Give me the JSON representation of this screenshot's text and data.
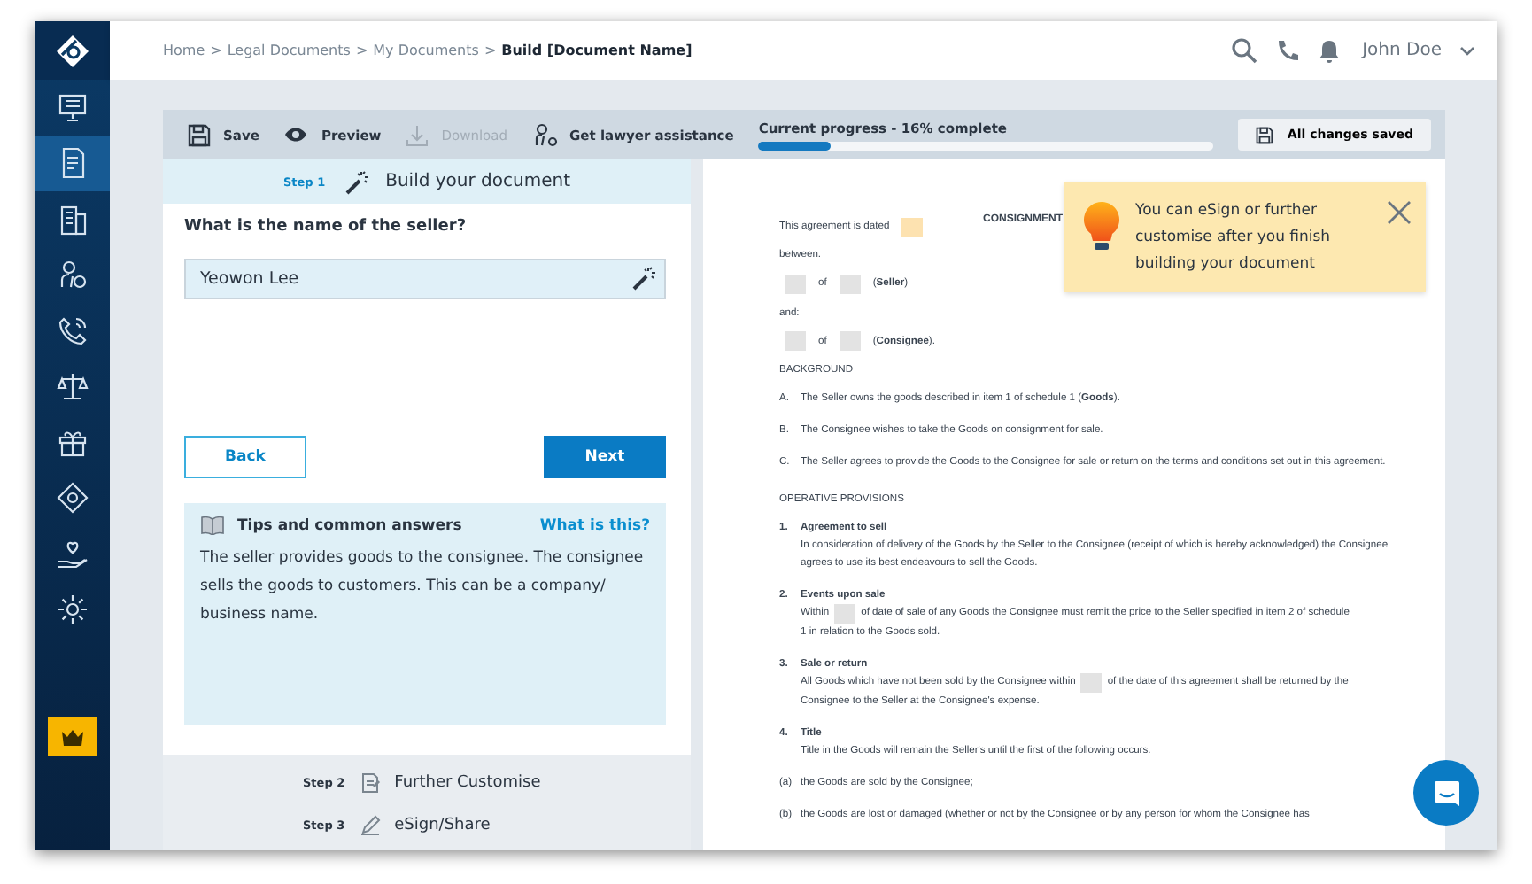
{
  "sidebar": {
    "items": [
      {
        "selected": false
      },
      {
        "selected": true
      },
      {
        "selected": false
      },
      {
        "selected": false
      },
      {
        "selected": false
      },
      {
        "selected": false
      },
      {
        "selected": false
      },
      {
        "selected": false
      },
      {
        "selected": false
      },
      {
        "selected": false
      }
    ]
  },
  "breadcrumb": [
    {
      "text": "Home",
      "current": false
    },
    {
      "text": "Legal Documents",
      "current": false
    },
    {
      "text": "My Documents",
      "current": false
    },
    {
      "text": "Build [Document Name]",
      "current": true
    }
  ],
  "breadcrumb_separator": ">",
  "user": {
    "name": "John Doe"
  },
  "toolbar": {
    "actions": [
      {
        "label": "Save",
        "disabled": false
      },
      {
        "label": "Preview",
        "disabled": false
      },
      {
        "label": "Download",
        "disabled": true
      },
      {
        "label": "Get lawyer assistance",
        "disabled": false
      }
    ],
    "progress": {
      "label": "Current progress - 16% complete",
      "level": 0.16
    },
    "save_status": "All changes saved"
  },
  "steps": [
    {
      "number": "Step 1",
      "title": "Build your document",
      "selected": true
    },
    {
      "number": "Step 2",
      "title": "Further Customise",
      "selected": false
    },
    {
      "number": "Step 3",
      "title": "eSign/Share",
      "selected": false
    }
  ],
  "question": {
    "label": "What is the name of the seller?",
    "value": "Yeowon Lee"
  },
  "buttons": {
    "back": "Back",
    "next": "Next"
  },
  "tips": {
    "title": "Tips and common answers",
    "link": "What is this?",
    "text": "The seller provides goods to the consignee. The consignee sells the goods to customers. This can be a company/ business name."
  },
  "document": {
    "title": "CONSIGNMENT",
    "blocks": [
      {
        "kind": "para",
        "parts": [
          {
            "kind": "text",
            "text": "This agreement is dated"
          },
          {
            "kind": "blank",
            "color": "#fde2b0"
          }
        ]
      },
      {
        "kind": "para",
        "parts": [
          {
            "kind": "text",
            "text": "between:"
          }
        ]
      },
      {
        "kind": "para",
        "parts": [
          {
            "kind": "blank",
            "color": "#e3e3e3"
          },
          {
            "kind": "text",
            "text": "of"
          },
          {
            "kind": "blank",
            "color": "#e3e3e3"
          },
          {
            "kind": "text",
            "text": "(**Seller**)"
          }
        ]
      },
      {
        "kind": "para",
        "parts": [
          {
            "kind": "text",
            "text": "and:"
          }
        ]
      },
      {
        "kind": "para",
        "parts": [
          {
            "kind": "blank",
            "color": "#e3e3e3"
          },
          {
            "kind": "text",
            "text": "of"
          },
          {
            "kind": "blank",
            "color": "#e3e3e3"
          },
          {
            "kind": "text",
            "text": "(**Consignee**)."
          }
        ]
      },
      {
        "kind": "heading",
        "text": "BACKGROUND"
      },
      {
        "kind": "item",
        "marker": "A.",
        "parts": [
          {
            "kind": "text",
            "text": "The Seller owns the goods described in item 1 of schedule 1 (**Goods**)."
          }
        ]
      },
      {
        "kind": "item",
        "marker": "B.",
        "parts": [
          {
            "kind": "text",
            "text": "The Consignee wishes to take the Goods on consignment for sale."
          }
        ]
      },
      {
        "kind": "item",
        "marker": "C.",
        "parts": [
          {
            "kind": "text",
            "text": "The Seller agrees to provide the Goods to the Consignee for sale or return on the terms and conditions set out in this agreement."
          }
        ]
      },
      {
        "kind": "heading",
        "text": "OPERATIVE PROVISIONS"
      },
      {
        "kind": "clause",
        "marker": "1.",
        "title": "Agreement to sell",
        "parts": [
          {
            "kind": "text",
            "text": "In consideration of delivery of the Goods by the Seller to the Consignee (receipt of which is hereby acknowledged) the Consignee agrees to use its best endeavours to sell the Goods."
          }
        ]
      },
      {
        "kind": "clause",
        "marker": "2.",
        "title": "Events upon sale",
        "parts": [
          {
            "kind": "text",
            "text": "Within"
          },
          {
            "kind": "blank",
            "color": "#e3e3e3"
          },
          {
            "kind": "text",
            "text": "of date of sale of any Goods the Consignee must remit the price to the Seller specified in item 2 of schedule"
          },
          {
            "kind": "text",
            "text": "1 in relation to the Goods sold."
          }
        ]
      },
      {
        "kind": "clause",
        "marker": "3.",
        "title": "Sale or return",
        "parts": [
          {
            "kind": "text",
            "text": "All Goods which have not been sold by the Consignee within"
          },
          {
            "kind": "blank",
            "color": "#e3e3e3"
          },
          {
            "kind": "text",
            "text": "of the date of this agreement shall be returned by the"
          },
          {
            "kind": "text",
            "text": "Consignee to the Seller at the Consignee's expense."
          }
        ]
      },
      {
        "kind": "clause",
        "marker": "4.",
        "title": "Title",
        "parts": [
          {
            "kind": "text",
            "text": "Title in the Goods will remain the Seller's until the first of the following occurs:"
          }
        ]
      },
      {
        "kind": "subitem",
        "marker": "(a)",
        "parts": [
          {
            "kind": "text",
            "text": "the Goods are sold by the Consignee;"
          }
        ]
      },
      {
        "kind": "subitem",
        "marker": "(b)",
        "parts": [
          {
            "kind": "text",
            "text": "the Goods are lost or damaged (whether or not by the Consignee or by any person for whom the Consignee has"
          }
        ]
      }
    ]
  },
  "tooltip": {
    "text": "You can eSign or further customise after you finish building your document"
  }
}
